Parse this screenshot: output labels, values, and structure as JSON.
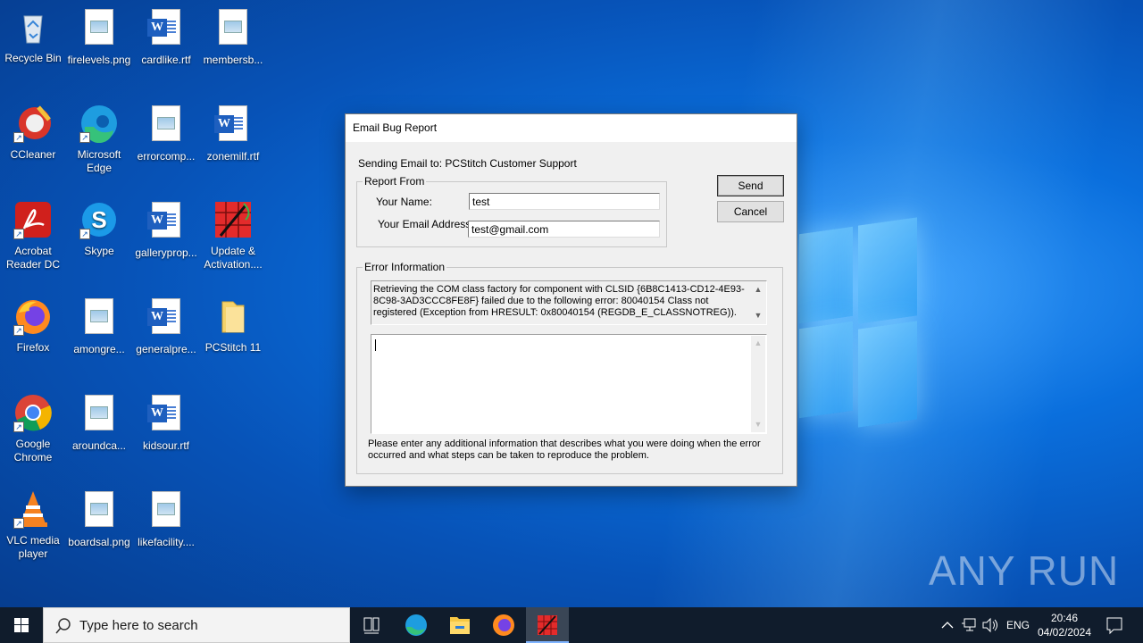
{
  "desktop": {
    "icons": [
      {
        "label": "Recycle Bin"
      },
      {
        "label": "firelevels.png"
      },
      {
        "label": "cardlike.rtf"
      },
      {
        "label": "membersb..."
      },
      {
        "label": "CCleaner"
      },
      {
        "label": "Microsoft Edge"
      },
      {
        "label": "errorcomp..."
      },
      {
        "label": "zonemilf.rtf"
      },
      {
        "label": "Acrobat Reader DC"
      },
      {
        "label": "Skype"
      },
      {
        "label": "galleryprop..."
      },
      {
        "label": "Update & Activation...."
      },
      {
        "label": "Firefox"
      },
      {
        "label": "amongre..."
      },
      {
        "label": "generalpre..."
      },
      {
        "label": "PCStitch 11"
      },
      {
        "label": "Google Chrome"
      },
      {
        "label": "aroundca..."
      },
      {
        "label": "kidsour.rtf"
      },
      {
        "label": "VLC media player"
      },
      {
        "label": "boardsal.png"
      },
      {
        "label": "likefacility...."
      }
    ]
  },
  "dialog": {
    "title": "Email Bug Report",
    "sending_label": "Sending Email to:",
    "sending_to": "PCStitch Customer Support",
    "report_from_legend": "Report From",
    "name_label": "Your Name:",
    "name_value": "test",
    "email_label": "Your Email Address:",
    "email_value": "test@gmail.com",
    "send_label": "Send",
    "cancel_label": "Cancel",
    "error_legend": "Error Information",
    "error_text": "Retrieving the COM class factory for component with CLSID {6B8C1413-CD12-4E93-8C98-3AD3CCC8FE8F} failed due to the following error: 80040154 Class not registered (Exception from HRESULT: 0x80040154 (REGDB_E_CLASSNOTREG)).",
    "additional_info_value": "",
    "hint_text": "Please enter any additional information that describes what you were doing when the error occurred and what steps can be taken to reproduce the problem."
  },
  "watermark": "ANY RUN",
  "taskbar": {
    "search_placeholder": "Type here to search",
    "language": "ENG",
    "time": "20:46",
    "date": "04/02/2024"
  }
}
